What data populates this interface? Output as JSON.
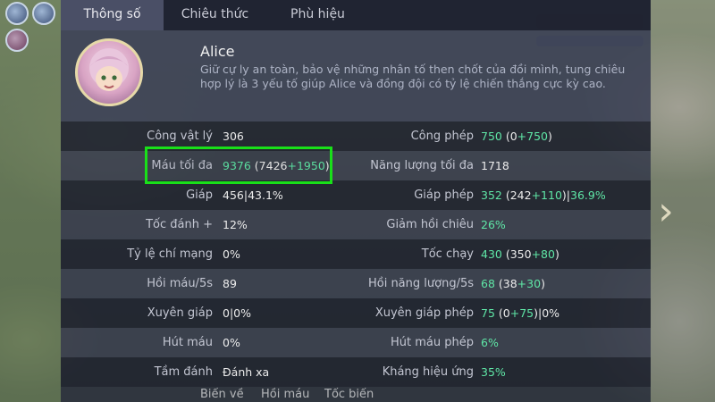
{
  "tabs": [
    {
      "label": "Thông số",
      "active": true
    },
    {
      "label": "Chiêu thức",
      "active": false
    },
    {
      "label": "Phù hiệu",
      "active": false
    }
  ],
  "hero": {
    "name": "Alice",
    "description": "Giữ cự ly an toàn, bảo vệ những nhân tố then chốt của đồi mình, tung chiêu hợp lý là 3 yếu tố giúp Alice và đồng đội có tỷ lệ chiến thắng cực kỳ cao."
  },
  "stats_left": [
    {
      "label": "Công vật lý",
      "parts": [
        {
          "t": "306",
          "c": "w"
        }
      ]
    },
    {
      "label": "Máu tối đa",
      "parts": [
        {
          "t": "9376",
          "c": "g"
        },
        {
          "t": " (7426",
          "c": "w"
        },
        {
          "t": "+1950",
          "c": "g"
        },
        {
          "t": ")",
          "c": "w"
        }
      ]
    },
    {
      "label": "Giáp",
      "parts": [
        {
          "t": "456|43.1%",
          "c": "w"
        }
      ]
    },
    {
      "label": "Tốc đánh +",
      "parts": [
        {
          "t": "12%",
          "c": "w"
        }
      ]
    },
    {
      "label": "Tỷ lệ chí mạng",
      "parts": [
        {
          "t": "0%",
          "c": "w"
        }
      ]
    },
    {
      "label": "Hồi máu/5s",
      "parts": [
        {
          "t": "89",
          "c": "w"
        }
      ]
    },
    {
      "label": "Xuyên giáp",
      "parts": [
        {
          "t": "0|0%",
          "c": "w"
        }
      ]
    },
    {
      "label": "Hút máu",
      "parts": [
        {
          "t": "0%",
          "c": "w"
        }
      ]
    },
    {
      "label": "Tầm đánh",
      "parts": [
        {
          "t": "Đánh xa",
          "c": "w"
        }
      ]
    }
  ],
  "stats_right": [
    {
      "label": "Công phép",
      "parts": [
        {
          "t": "750",
          "c": "g"
        },
        {
          "t": " (0",
          "c": "w"
        },
        {
          "t": "+750",
          "c": "g"
        },
        {
          "t": ")",
          "c": "w"
        }
      ]
    },
    {
      "label": "Năng lượng tối đa",
      "parts": [
        {
          "t": "1718",
          "c": "w"
        }
      ]
    },
    {
      "label": "Giáp phép",
      "parts": [
        {
          "t": "352",
          "c": "g"
        },
        {
          "t": " (242",
          "c": "w"
        },
        {
          "t": "+110",
          "c": "g"
        },
        {
          "t": ")|",
          "c": "w"
        },
        {
          "t": "36.9%",
          "c": "g"
        }
      ]
    },
    {
      "label": "Giảm hồi chiêu",
      "parts": [
        {
          "t": "26%",
          "c": "g"
        }
      ]
    },
    {
      "label": "Tốc chạy",
      "parts": [
        {
          "t": "430",
          "c": "g"
        },
        {
          "t": " (350",
          "c": "w"
        },
        {
          "t": "+80",
          "c": "g"
        },
        {
          "t": ")",
          "c": "w"
        }
      ]
    },
    {
      "label": "Hồi năng lượng/5s",
      "parts": [
        {
          "t": "68",
          "c": "g"
        },
        {
          "t": " (38",
          "c": "w"
        },
        {
          "t": "+30",
          "c": "g"
        },
        {
          "t": ")",
          "c": "w"
        }
      ]
    },
    {
      "label": "Xuyên giáp phép",
      "parts": [
        {
          "t": "75",
          "c": "g"
        },
        {
          "t": " (0",
          "c": "w"
        },
        {
          "t": "+75",
          "c": "g"
        },
        {
          "t": ")|0%",
          "c": "w"
        }
      ]
    },
    {
      "label": "Hút máu phép",
      "parts": [
        {
          "t": "6%",
          "c": "g"
        }
      ]
    },
    {
      "label": "Kháng hiệu ứng",
      "parts": [
        {
          "t": "35%",
          "c": "g"
        }
      ]
    }
  ],
  "bottom_labels": [
    "Biến về",
    "Hồi máu",
    "Tốc biến"
  ],
  "colors": {
    "accent_green": "#5fe6a6",
    "highlight_box": "#19e019"
  }
}
